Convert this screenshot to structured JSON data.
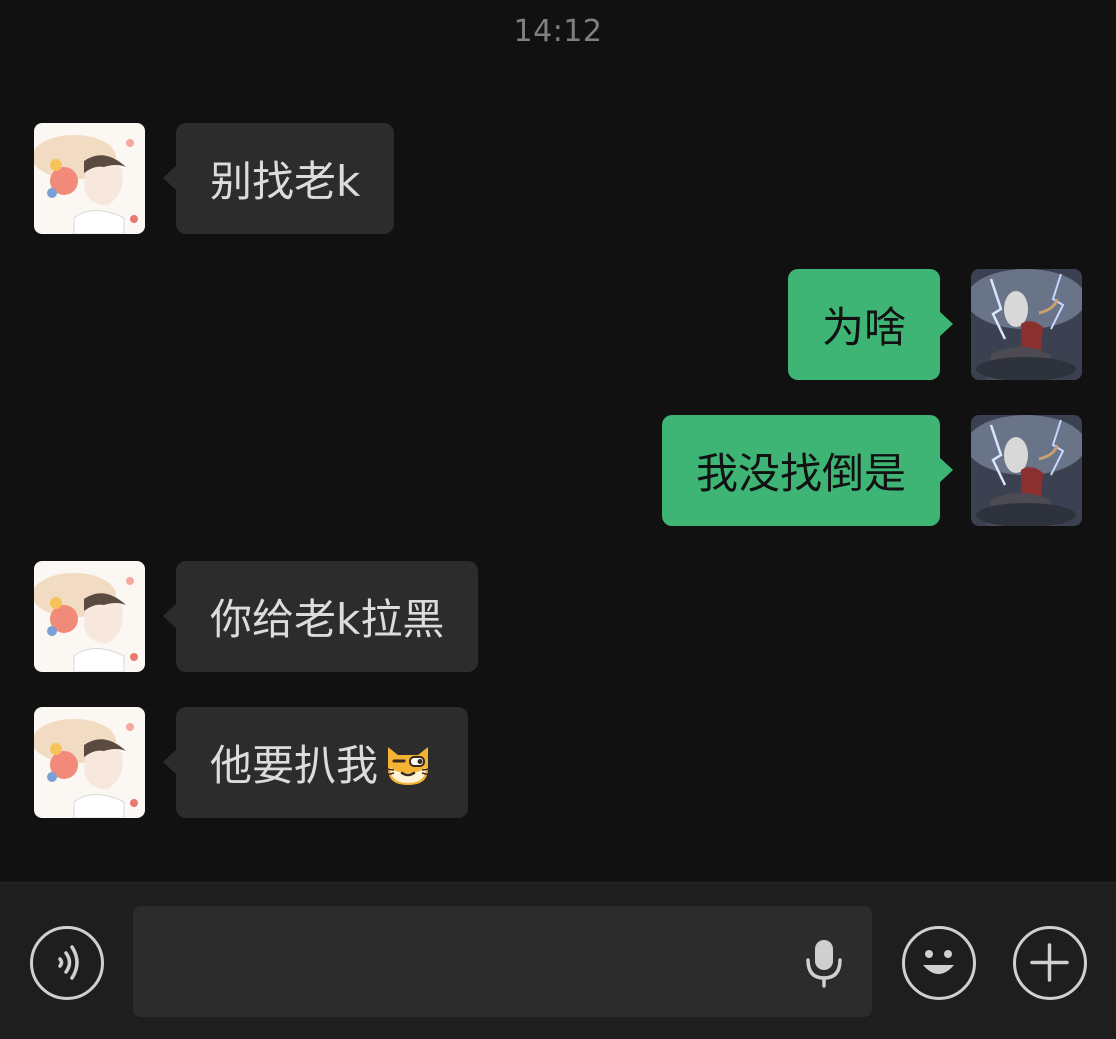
{
  "chat": {
    "timestamp": "14:12",
    "messages": [
      {
        "direction": "in",
        "avatar": "contact-avatar",
        "text": "别找老k"
      },
      {
        "direction": "out",
        "avatar": "self-avatar",
        "text": "为啥"
      },
      {
        "direction": "out",
        "avatar": "self-avatar",
        "text": "我没找倒是"
      },
      {
        "direction": "in",
        "avatar": "contact-avatar",
        "text": "你给老k拉黑"
      },
      {
        "direction": "in",
        "avatar": "contact-avatar",
        "text": "他要扒我",
        "emoji": "smirking-cat-emoji"
      }
    ]
  },
  "input_bar": {
    "value": "",
    "icons": {
      "voice": "voice-mode-icon",
      "mic": "microphone-icon",
      "emoji": "emoji-icon",
      "more": "plus-icon"
    }
  },
  "colors": {
    "background": "#111111",
    "incoming_bubble": "#2c2c2c",
    "outgoing_bubble": "#3eb575",
    "toolbar": "#1e1e1e"
  }
}
